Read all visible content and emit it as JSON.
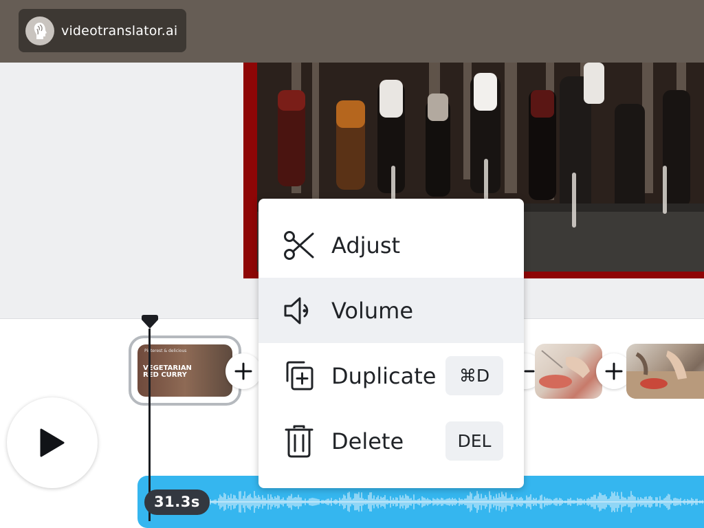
{
  "brand": {
    "name": "videotranslator.ai",
    "logo_icon": "face-profile-icon"
  },
  "preview": {
    "border_color": "#8e0606"
  },
  "timeline": {
    "selected_clip": {
      "small_text": "Pinterest & delicious",
      "title_line1": "VEGETARIAN",
      "title_line2": "RED CURRY"
    },
    "add_icon": "plus-icon",
    "play_icon": "play-icon",
    "audio_duration": "31.3s",
    "audio_color": "#35b6ef"
  },
  "context_menu": {
    "items": [
      {
        "label": "Adjust",
        "icon": "scissors-icon",
        "shortcut": ""
      },
      {
        "label": "Volume",
        "icon": "speaker-icon",
        "shortcut": ""
      },
      {
        "label": "Duplicate",
        "icon": "duplicate-icon",
        "shortcut": "⌘D"
      },
      {
        "label": "Delete",
        "icon": "trash-icon",
        "shortcut": "DEL"
      }
    ]
  }
}
